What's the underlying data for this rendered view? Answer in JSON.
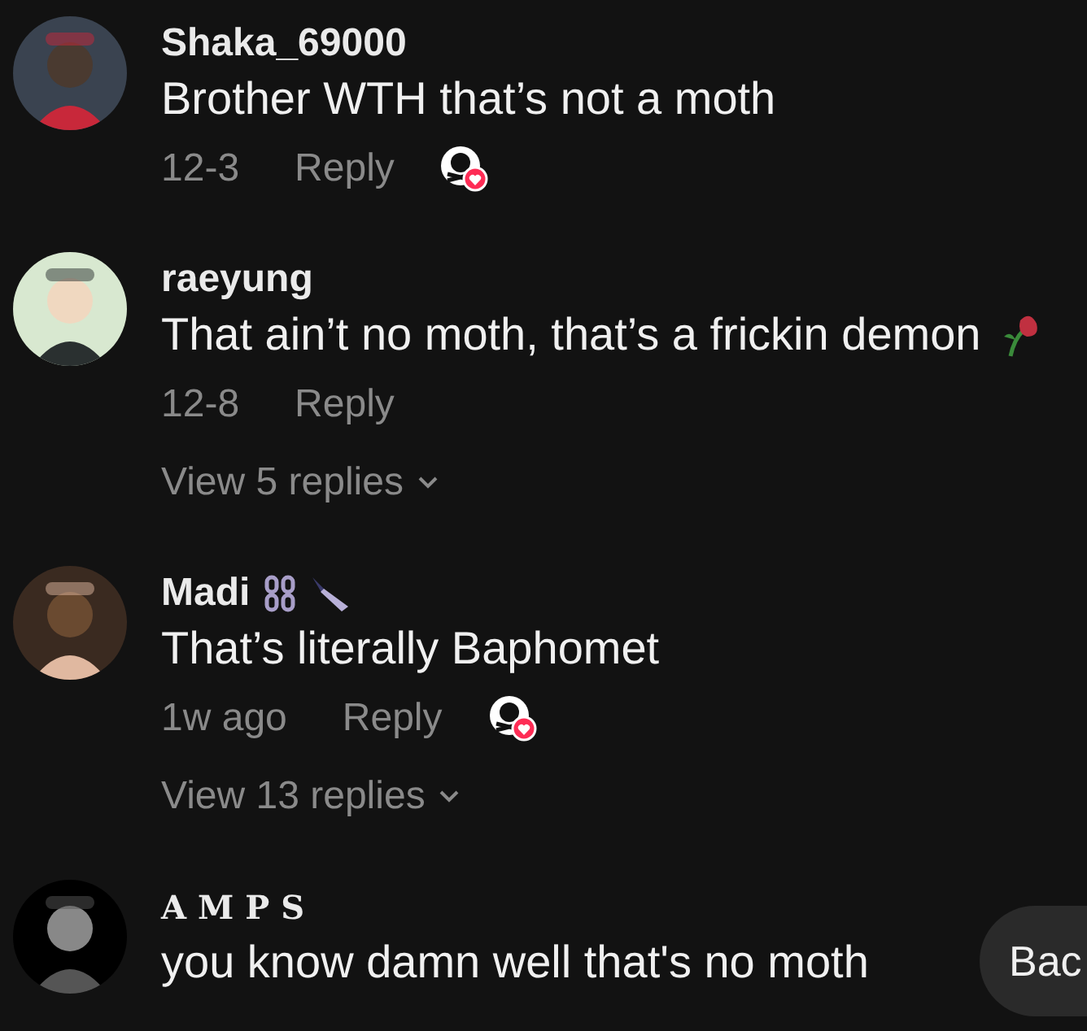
{
  "comments": [
    {
      "username": "Shaka_69000",
      "serif_name": false,
      "name_emoji": false,
      "text": "Brother WTH that’s not a moth",
      "text_emoji": false,
      "date": "12-3",
      "reply": "Reply",
      "liked_by_creator": true
    },
    {
      "username": "raeyung",
      "serif_name": false,
      "name_emoji": false,
      "text": "That ain’t no moth, that’s a frickin demon",
      "text_emoji": true,
      "date": "12-8",
      "reply": "Reply",
      "liked_by_creator": false,
      "view_replies": "View 5 replies"
    },
    {
      "username": "Madi",
      "serif_name": false,
      "name_emoji": true,
      "text": "That’s literally Baphomet",
      "text_emoji": false,
      "date": "1w ago",
      "reply": "Reply",
      "liked_by_creator": true,
      "view_replies": "View 13 replies"
    },
    {
      "username": "A M P S",
      "serif_name": true,
      "name_emoji": false,
      "text": "you know damn well that's no moth",
      "text_emoji": false
    }
  ],
  "back_button": "Bac"
}
